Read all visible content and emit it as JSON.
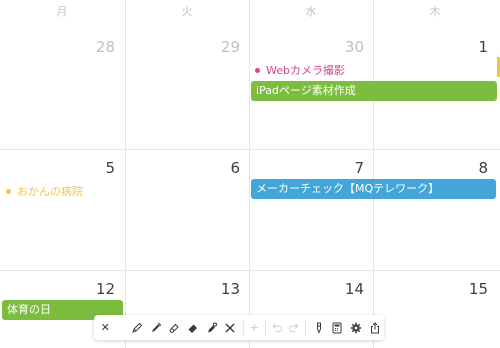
{
  "weekdays": [
    "月",
    "火",
    "水",
    "木"
  ],
  "days": {
    "r1": [
      "28",
      "29",
      "30",
      "1"
    ],
    "r2": [
      "5",
      "6",
      "7",
      "8"
    ],
    "r3": [
      "12",
      "13",
      "14",
      "15"
    ]
  },
  "events": {
    "webcam": "Webカメラ撮影",
    "ipad": "iPadページ素材作成",
    "hospital": "おかんの病院",
    "maker_check": "メーカーチェック【MQテレワーク】",
    "sports_day": "体育の日"
  },
  "colors": {
    "pink": "#d5458c",
    "green": "#7cbd3f",
    "yellow": "#f2c53d",
    "blue": "#43a5d8"
  },
  "toolbar": {
    "close": "✕",
    "pencil": "pencil-icon",
    "marker": "marker-icon",
    "highlighter": "highlighter-icon",
    "eraser": "eraser-icon",
    "lasso": "lasso-icon",
    "clear": "clear-icon",
    "add": "+",
    "undo": "undo-icon",
    "redo": "redo-icon",
    "pen_settings": "pen-settings-icon",
    "calculator": "calculator-icon",
    "settings": "gear-icon",
    "share": "share-icon"
  }
}
